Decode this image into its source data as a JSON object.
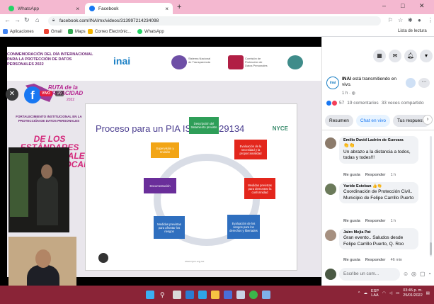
{
  "browser": {
    "tabs": [
      {
        "label": "WhatsApp",
        "active": false
      },
      {
        "label": "Facebook",
        "active": true
      }
    ],
    "url": "facebook.com/INAImx/videos/313997214234098",
    "bookmarks": [
      "Aplicaciones",
      "Gmail",
      "Maps",
      "Correo Electrónic...",
      "WhatsApp"
    ],
    "reading_list": "Lista de lectura"
  },
  "video": {
    "conference_title": "CONMEMORACIÓN DEL DÍA INTERNACIONAL PARA LA PROTECCIÓN DE DATOS PERSONALES 2022",
    "logo_inai": "inai",
    "org_logos": [
      {
        "text": "Sistema Nacional de Transparencia"
      },
      {
        "text": "Comisión de Protección de Datos Personales"
      }
    ],
    "ruta_title": "RUTA de la PRIVACIDAD",
    "ruta_year": "2022",
    "fortalecimiento": "FORTALECIMIENTO INSTITUCIONAL EN LA PROTECCIÓN DE DATOS PERSONALES",
    "estandares": "DE LOS ESTÁNDARES INTERNACIONALES AL ÁMBITO LOCAL",
    "slide_title": "Proceso para un PIA ISO/IEC 29134",
    "slide_brand": "NYCE",
    "slide_brand_sub": "",
    "steps": [
      "Descripción del tratamiento previsto",
      "Evaluación de la necesidad y la proporcionalidad",
      "Medidas previstas para demostrar la conformidad",
      "Evaluación de los riesgos para los derechos y libertades",
      "Medidas previstas para afrontar los riesgos",
      "Documentación",
      "Supervisión y revisión"
    ],
    "slide_url": "www.nyce.org.mx",
    "live_badge": "VIVO",
    "viewers": "20"
  },
  "panel": {
    "page_name": "INAI",
    "status": "está transmitiendo en vivo.",
    "time": "1 h",
    "reactions": "57",
    "comments_count": "19 comentarios",
    "shares": "33 veces compartido",
    "tabs": [
      "Resumen",
      "Chat en vivo",
      "Tus respuesta"
    ],
    "comments": [
      {
        "name": "Emilio David Ladrón de Guevara",
        "text": "Un abrazo a la distancia a todos, todas y todes!!!",
        "like": "Me gusta",
        "reply": "Responder",
        "time": "1 h"
      },
      {
        "name": "Yaride Esteban",
        "text": "Coordinación de Protección Civil.. Municipio de Felipe Carrillo Puerto",
        "like": "Me gusta",
        "reply": "Responder",
        "time": "1 h"
      },
      {
        "name": "Jairo Mejia Pat",
        "text": "Gran evento.. Saludos desde Felipe Carrillo Puerto, Q. Roo",
        "like": "Me gusta",
        "reply": "Responder",
        "time": "46 min"
      }
    ],
    "composer_placeholder": "Escribe un com..."
  },
  "taskbar": {
    "lang": "ESP",
    "lang2": "LAA",
    "time": "03:45 p. m.",
    "date": "25/01/2022"
  },
  "colors": {
    "tab_strip": "#f4b8d0",
    "fb_blue": "#1877f2",
    "taskbar": "#8a2437"
  }
}
